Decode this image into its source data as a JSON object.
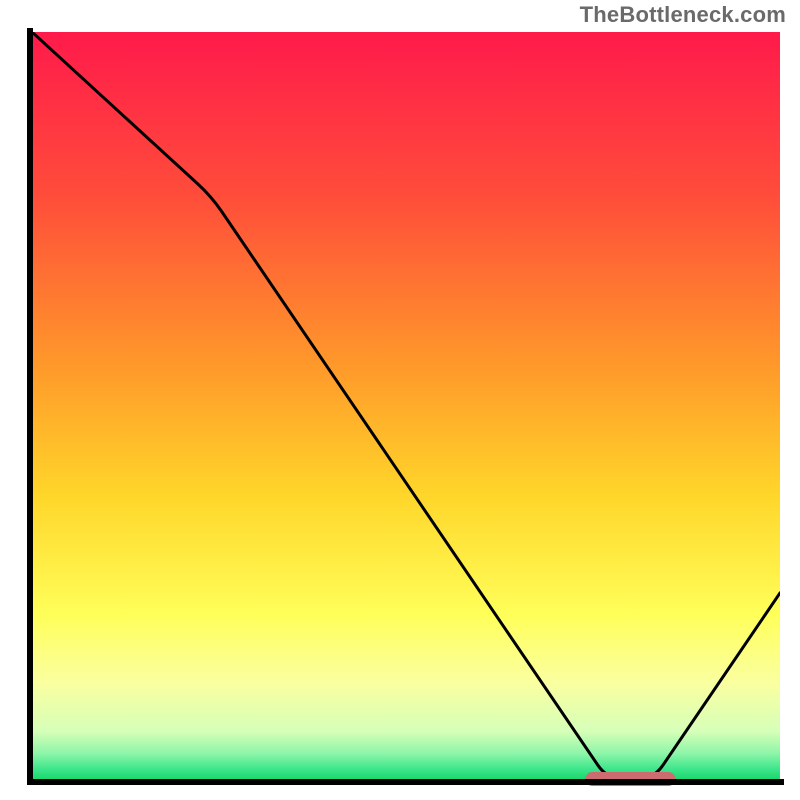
{
  "watermark": "TheBottleneck.com",
  "chart_data": {
    "type": "line",
    "title": "",
    "xlabel": "",
    "ylabel": "",
    "xlim": [
      0,
      100
    ],
    "ylim": [
      0,
      100
    ],
    "x": [
      0,
      24,
      77,
      83,
      100
    ],
    "values": [
      100,
      78,
      0,
      0,
      25
    ],
    "optimum_band": {
      "x_start": 74,
      "x_end": 86,
      "y": 0
    },
    "gradient_stops": [
      {
        "offset": 0.0,
        "color": "#ff1a4b"
      },
      {
        "offset": 0.22,
        "color": "#ff4d3a"
      },
      {
        "offset": 0.45,
        "color": "#ff9a2a"
      },
      {
        "offset": 0.62,
        "color": "#ffd62a"
      },
      {
        "offset": 0.78,
        "color": "#ffff5a"
      },
      {
        "offset": 0.87,
        "color": "#faffa0"
      },
      {
        "offset": 0.935,
        "color": "#d6ffb8"
      },
      {
        "offset": 0.965,
        "color": "#8cf5a8"
      },
      {
        "offset": 0.985,
        "color": "#3fe68c"
      },
      {
        "offset": 1.0,
        "color": "#17d66b"
      }
    ],
    "grid": false,
    "legend": false
  }
}
